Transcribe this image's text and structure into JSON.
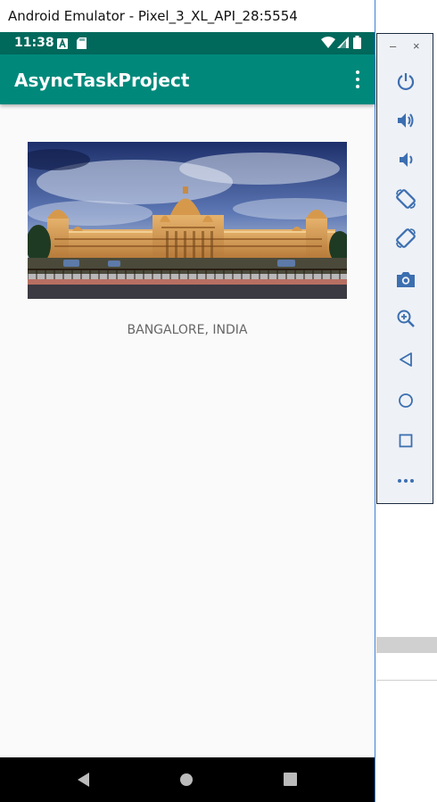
{
  "window": {
    "title": "Android Emulator - Pixel_3_XL_API_28:5554"
  },
  "status_bar": {
    "time": "11:38"
  },
  "app_bar": {
    "title": "AsyncTaskProject"
  },
  "content": {
    "caption": "BANGALORE, INDIA"
  },
  "side_panel": {
    "minimize_label": "–",
    "close_label": "×",
    "tools": [
      "power-icon",
      "volume-up-icon",
      "volume-down-icon",
      "rotate-left-icon",
      "rotate-right-icon",
      "camera-icon",
      "zoom-icon",
      "back-icon",
      "home-icon",
      "overview-icon",
      "more-icon"
    ]
  },
  "colors": {
    "status_bar": "#00695c",
    "app_bar": "#00897b",
    "nav_bar": "#000000",
    "panel_icon": "#3c6fb0"
  }
}
